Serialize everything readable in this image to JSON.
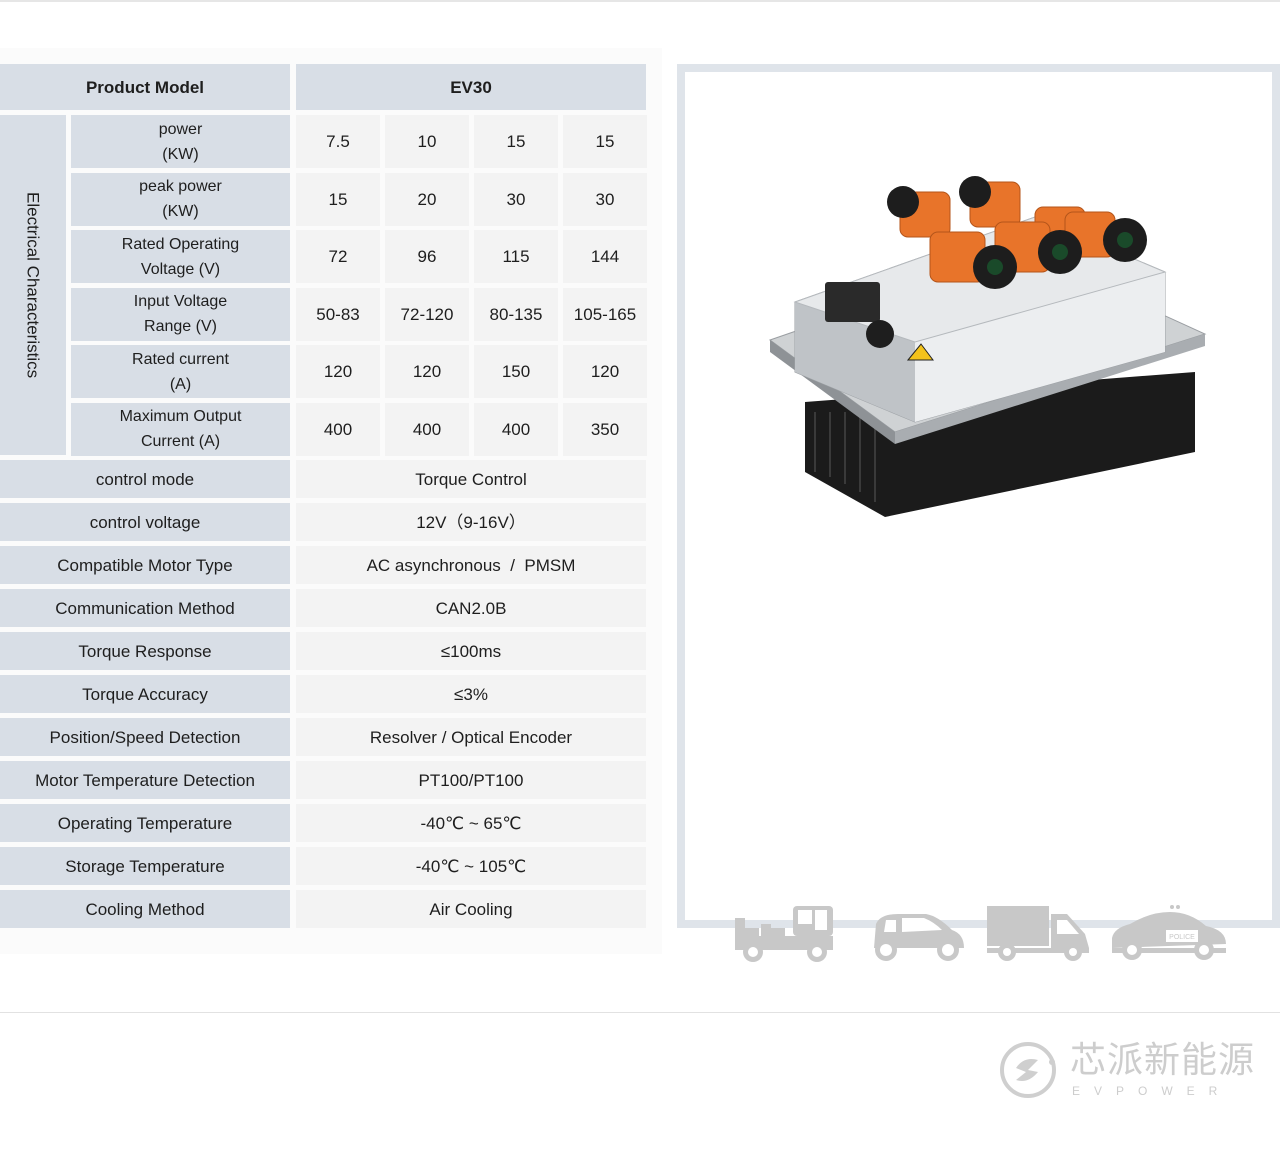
{
  "table": {
    "header": {
      "label": "Product Model",
      "model": "EV30"
    },
    "group_label": "Electrical Characteristics",
    "electrical_rows": [
      {
        "label_line1": "power",
        "label_line2": "(KW)",
        "values": [
          "7.5",
          "10",
          "15",
          "15"
        ]
      },
      {
        "label_line1": "peak power",
        "label_line2": "(KW)",
        "values": [
          "15",
          "20",
          "30",
          "30"
        ]
      },
      {
        "label_line1": "Rated Operating",
        "label_line2": "Voltage (V)",
        "values": [
          "72",
          "96",
          "115",
          "144"
        ]
      },
      {
        "label_line1": "Input Voltage",
        "label_line2": "Range (V)",
        "values": [
          "50-83",
          "72-120",
          "80-135",
          "105-165"
        ]
      },
      {
        "label_line1": "Rated current",
        "label_line2": "(A)",
        "values": [
          "120",
          "120",
          "150",
          "120"
        ]
      },
      {
        "label_line1": "Maximum Output",
        "label_line2": "Current (A)",
        "values": [
          "400",
          "400",
          "400",
          "350"
        ]
      }
    ],
    "spec_rows": [
      {
        "label": "control mode",
        "value": "Torque Control"
      },
      {
        "label": "control voltage",
        "value": "12V（9-16V）"
      },
      {
        "label": "Compatible Motor Type",
        "value": "AC asynchronous  /  PMSM"
      },
      {
        "label": "Communication Method",
        "value": "CAN2.0B"
      },
      {
        "label": "Torque Response",
        "value": "≤100ms"
      },
      {
        "label": "Torque Accuracy",
        "value": "≤3%"
      },
      {
        "label": "Position/Speed Detection",
        "value": "Resolver / Optical Encoder"
      },
      {
        "label": "Motor Temperature Detection",
        "value": "PT100/PT100"
      },
      {
        "label": "Operating Temperature",
        "value": "-40℃ ~ 65℃"
      },
      {
        "label": "Storage Temperature",
        "value": "-40℃ ~ 105℃"
      },
      {
        "label": "Cooling Method",
        "value": "Air Cooling"
      }
    ]
  },
  "product_image": {
    "alt": "EV30 motor controller with orange connectors",
    "accent_color": "#e8742a"
  },
  "applications": [
    {
      "icon": "utility-truck-icon"
    },
    {
      "icon": "compact-car-icon"
    },
    {
      "icon": "box-truck-icon"
    },
    {
      "icon": "police-car-icon",
      "badge_text": "POLICE"
    }
  ],
  "brand": {
    "name_cn": "芯派新能源",
    "name_en": "EVPOWER"
  }
}
